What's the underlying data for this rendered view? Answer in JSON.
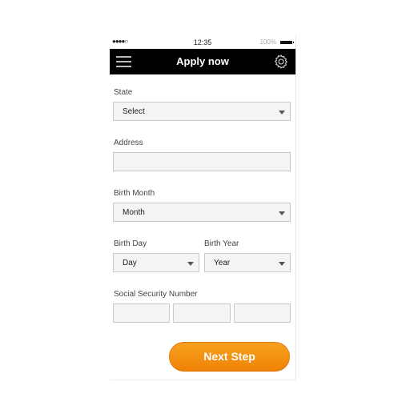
{
  "status_bar": {
    "signal": "●●●●○",
    "time": "12:35",
    "battery": "100%"
  },
  "nav": {
    "title": "Apply now",
    "menu_icon": "hamburger-icon",
    "settings_icon": "gear-icon"
  },
  "form": {
    "state": {
      "label": "State",
      "value": "Select"
    },
    "address": {
      "label": "Address",
      "value": ""
    },
    "birth_month": {
      "label": "Birth Month",
      "value": "Month"
    },
    "birth_day": {
      "label": "Birth Day",
      "value": "Day"
    },
    "birth_year": {
      "label": "Birth Year",
      "value": "Year"
    },
    "ssn": {
      "label": "Social Security Number",
      "parts": [
        "",
        "",
        ""
      ]
    }
  },
  "actions": {
    "next_label": "Next Step",
    "next_color": "#f39012"
  }
}
